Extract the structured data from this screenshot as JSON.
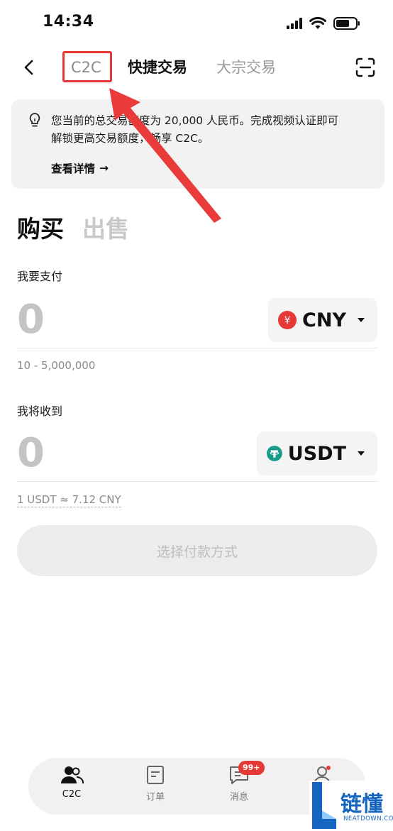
{
  "status_bar": {
    "time": "14:34"
  },
  "header": {
    "tabs": [
      {
        "label": "C2C"
      },
      {
        "label": "快捷交易"
      },
      {
        "label": "大宗交易"
      }
    ]
  },
  "notice": {
    "line1": "您当前的总交易额度为 20,000 人民币。完成视频认证即可",
    "line2": "解锁更高交易额度，畅享 C2C。",
    "link": "查看详情",
    "link_arrow": "→"
  },
  "trade_tabs": {
    "buy": "购买",
    "sell": "出售"
  },
  "pay": {
    "label": "我要支付",
    "amount": "0",
    "currency": "CNY",
    "currency_symbol": "¥",
    "range": "10 - 5,000,000"
  },
  "receive": {
    "label": "我将收到",
    "amount": "0",
    "currency": "USDT",
    "rate": "1 USDT ≈ 7.12 CNY"
  },
  "action": {
    "label": "选择付款方式"
  },
  "bottom_nav": {
    "items": [
      {
        "label": "C2C",
        "icon": "user-group-icon"
      },
      {
        "label": "订单",
        "icon": "order-icon"
      },
      {
        "label": "消息",
        "icon": "message-icon"
      },
      {
        "label": "",
        "icon": "profile-icon"
      }
    ],
    "badge": "99+"
  },
  "watermark": {
    "text": "链懂",
    "sub": "NEATDOWN.COM"
  },
  "colors": {
    "highlight": "#e53935",
    "cny": "#e53935",
    "usdt": "#1a9a8a",
    "watermark": "#1565c0"
  }
}
